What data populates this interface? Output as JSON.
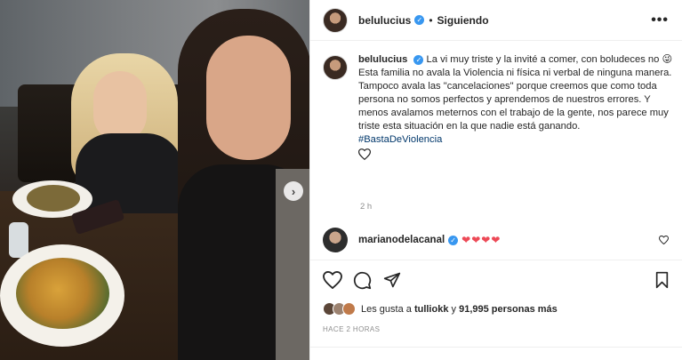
{
  "post": {
    "username": "belulucius",
    "following_label": "Siguiendo",
    "dot": "•",
    "more_label": "•••"
  },
  "caption": {
    "username": "belulucius",
    "line1": "La vi muy triste y la invité a comer, con boludeces no 😜",
    "text": "Esta familia no avala la Violencia ni física ni verbal de ninguna manera. Tampoco avala las \"cancelaciones\" porque creemos que como toda persona no somos perfectos y aprendemos de nuestros errores. Y menos avalamos meternos con el trabajo de la gente, nos parece muy triste esta situación en la que nadie está ganando.",
    "hashtag": "#BastaDeViolencia",
    "time": "2 h"
  },
  "comment": {
    "username": "marianodelacanal",
    "hearts": "❤❤❤❤"
  },
  "likes": {
    "prefix": "Les gusta a",
    "user": "tulliokk",
    "connector": "y",
    "count": "91,995 personas más"
  },
  "date": "HACE 2 HORAS",
  "colors": {
    "verified": "#3897f0",
    "heart": "#ed4956",
    "hashtag": "#00376b"
  },
  "icons": {
    "next": "chevron-right-icon",
    "like": "heart-icon",
    "comment": "comment-icon",
    "share": "paper-plane-icon",
    "save": "bookmark-icon"
  }
}
